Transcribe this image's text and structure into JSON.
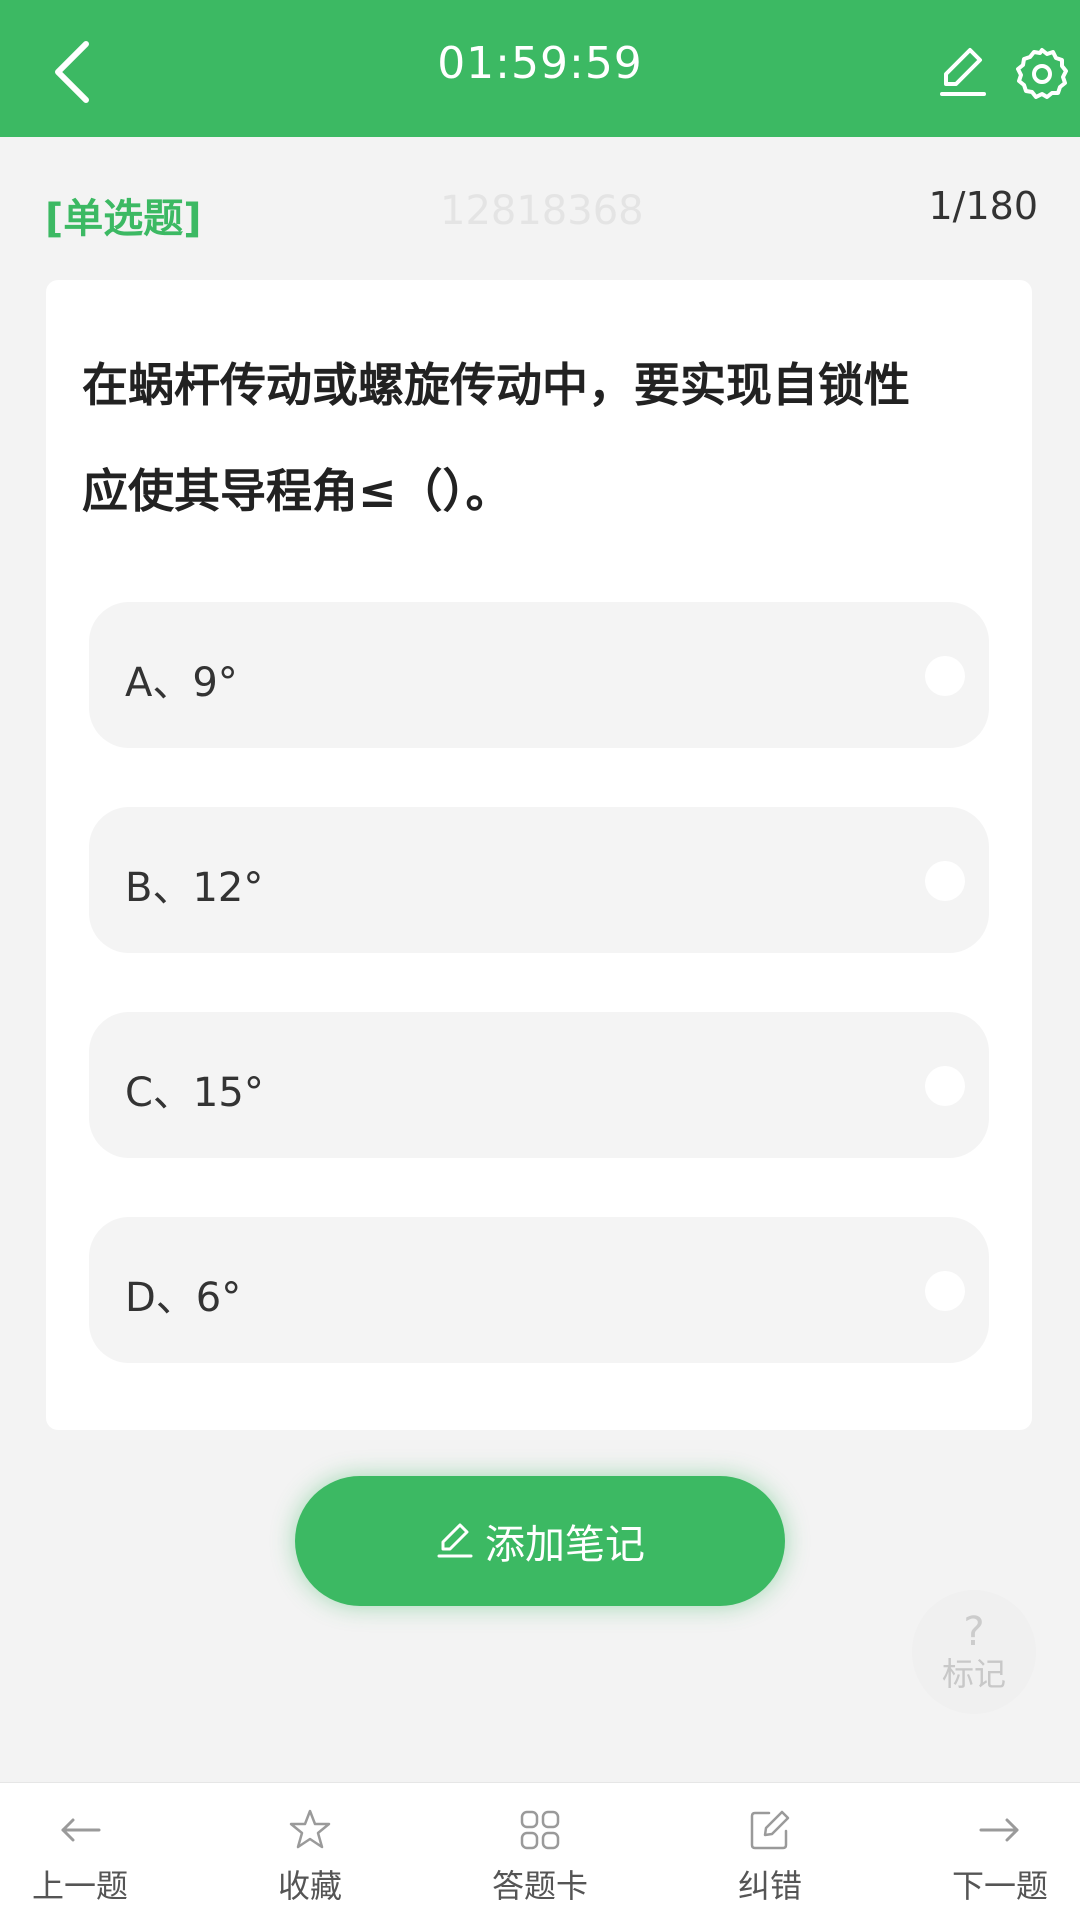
{
  "header": {
    "timer": "01:59:59",
    "back_icon": "chevron-left-icon",
    "edit_icon": "pencil-icon",
    "settings_icon": "gear-icon",
    "bg_color": "#3cb963"
  },
  "question": {
    "type_label": "[单选题]",
    "id": "12818368",
    "progress": "1/180",
    "text_line1": "在蜗杆传动或螺旋传动中，要实现自锁性",
    "text_line2": "应使其导程角≤（）。"
  },
  "options": [
    {
      "label": "A、9°"
    },
    {
      "label": "B、12°"
    },
    {
      "label": "C、15°"
    },
    {
      "label": "D、6°"
    }
  ],
  "add_note": {
    "label": "添加笔记",
    "icon": "pencil-icon"
  },
  "mark": {
    "symbol": "?",
    "label": "标记"
  },
  "bottom_nav": [
    {
      "label": "上一题",
      "icon": "arrow-left-icon"
    },
    {
      "label": "收藏",
      "icon": "star-icon"
    },
    {
      "label": "答题卡",
      "icon": "grid-icon"
    },
    {
      "label": "纠错",
      "icon": "edit-square-icon"
    },
    {
      "label": "下一题",
      "icon": "arrow-right-icon"
    }
  ],
  "accent_color": "#3cb963"
}
